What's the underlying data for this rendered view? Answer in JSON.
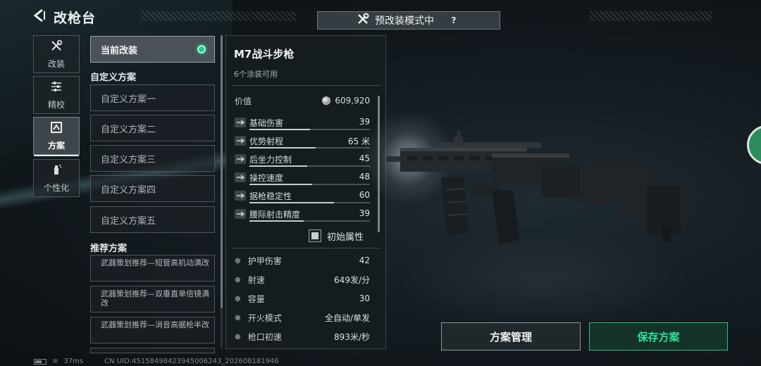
{
  "header": {
    "title": "改枪台",
    "mode_banner": "预改装模式中",
    "help_label": "?"
  },
  "side_tabs": [
    {
      "label": "改装",
      "icon": "wrench-screwdriver-icon",
      "active": false
    },
    {
      "label": "精校",
      "icon": "sliders-icon",
      "active": false
    },
    {
      "label": "方案",
      "icon": "blueprint-icon",
      "active": true
    },
    {
      "label": "个性化",
      "icon": "spray-can-icon",
      "active": false
    }
  ],
  "loadouts": {
    "current_label": "当前改装",
    "custom_heading": "自定义方案",
    "custom": [
      "自定义方案一",
      "自定义方案二",
      "自定义方案三",
      "自定义方案四",
      "自定义方案五"
    ],
    "recommended_heading": "推荐方案",
    "recommended": [
      "武器策划推荐—短管高机动满改",
      "武器策划推荐—双垂直单倍镜满改",
      "武器策划推荐—消音高据枪半改"
    ]
  },
  "weapon": {
    "name": "M7战斗步枪",
    "skins_available": "6个涂装可用",
    "price_label": "价值",
    "price_value": "609,920",
    "stats": [
      {
        "label": "基础伤害",
        "value": "39",
        "fill": 0.5,
        "icon": "damage-icon"
      },
      {
        "label": "优势射程",
        "value": "65 米",
        "fill": 0.55,
        "icon": "range-icon"
      },
      {
        "label": "后坐力控制",
        "value": "45",
        "fill": 0.48,
        "icon": "recoil-icon"
      },
      {
        "label": "操控速度",
        "value": "48",
        "fill": 0.52,
        "icon": "handling-icon"
      },
      {
        "label": "据枪稳定性",
        "value": "60",
        "fill": 0.7,
        "icon": "stability-icon"
      },
      {
        "label": "腰际射击精度",
        "value": "39",
        "fill": 0.45,
        "icon": "hipfire-icon"
      }
    ],
    "base_attr_label": "初始属性",
    "specs": [
      {
        "label": "护甲伤害",
        "value": "42"
      },
      {
        "label": "射速",
        "value": "649发/分"
      },
      {
        "label": "容量",
        "value": "30"
      },
      {
        "label": "开火模式",
        "value": "全自动/单发"
      },
      {
        "label": "枪口初速",
        "value": "893米/秒"
      }
    ]
  },
  "actions": {
    "manage_label": "方案管理",
    "save_label": "保存方案"
  },
  "status": {
    "ping": "37ms",
    "uid": "CN UID:451584984239450062​43_202608181946"
  },
  "colors": {
    "accent_green": "#2fe39a",
    "active_dot": "#1fd08a",
    "panel_bg": "#161c20"
  }
}
